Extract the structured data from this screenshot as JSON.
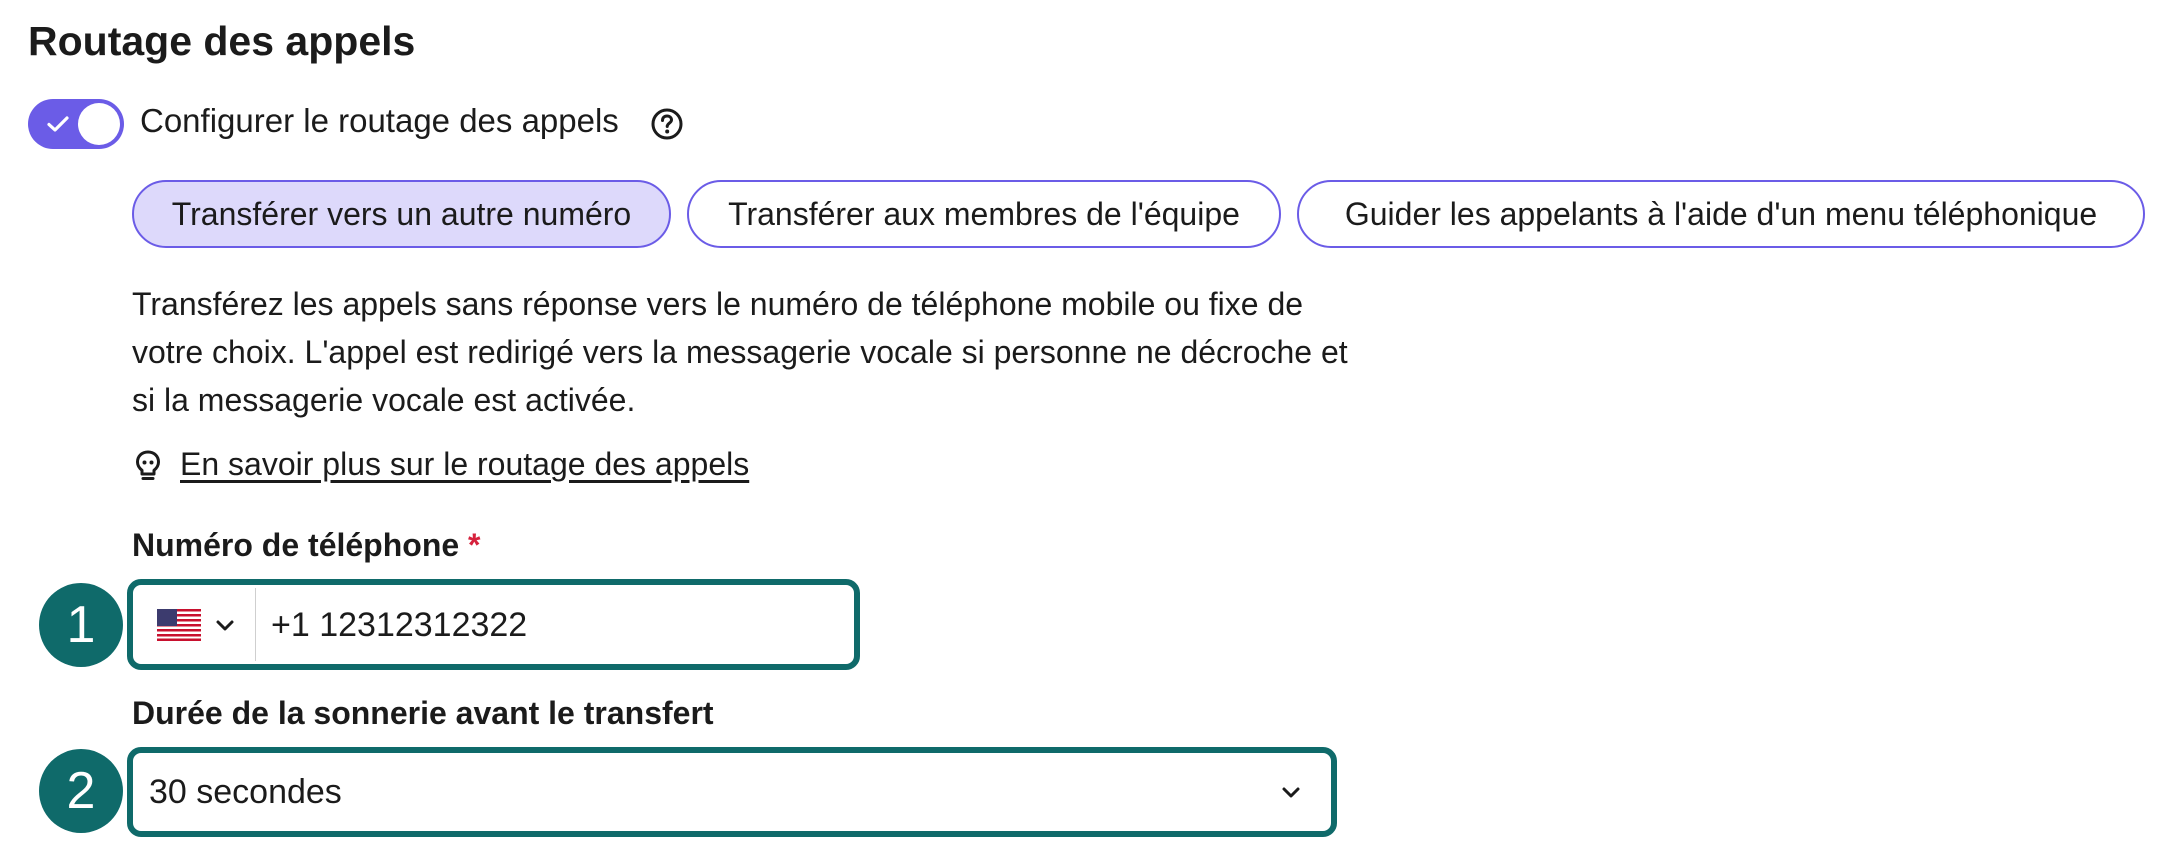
{
  "section": {
    "title": "Routage des appels"
  },
  "toggle": {
    "label": "Configurer le routage des appels",
    "enabled": true,
    "icon": "check-icon",
    "help_icon": "question-circle-icon",
    "accent": "#6b5ce7"
  },
  "options": [
    {
      "label": "Transférer vers un autre numéro",
      "selected": true
    },
    {
      "label": "Transférer aux membres de l'équipe",
      "selected": false
    },
    {
      "label": "Guider les appelants à l'aide d'un menu téléphonique",
      "selected": false
    }
  ],
  "description": "Transférez les appels sans réponse vers le numéro de téléphone mobile ou fixe de votre choix. L'appel est redirigé vers la messagerie vocale si personne ne décroche et si la messagerie vocale est activée.",
  "learn_more": {
    "icon": "lightbulb-icon",
    "link": "En savoir plus sur le routage des appels"
  },
  "phone": {
    "label": "Numéro de téléphone",
    "required_mark": "*",
    "country_flag": "us-flag-icon",
    "value": "+1 12312312322"
  },
  "ring": {
    "label": "Durée de la sonnerie avant le transfert",
    "value": "30 secondes"
  },
  "annotations": {
    "badge1": "1",
    "badge2": "2",
    "color": "#0f6a6a"
  }
}
